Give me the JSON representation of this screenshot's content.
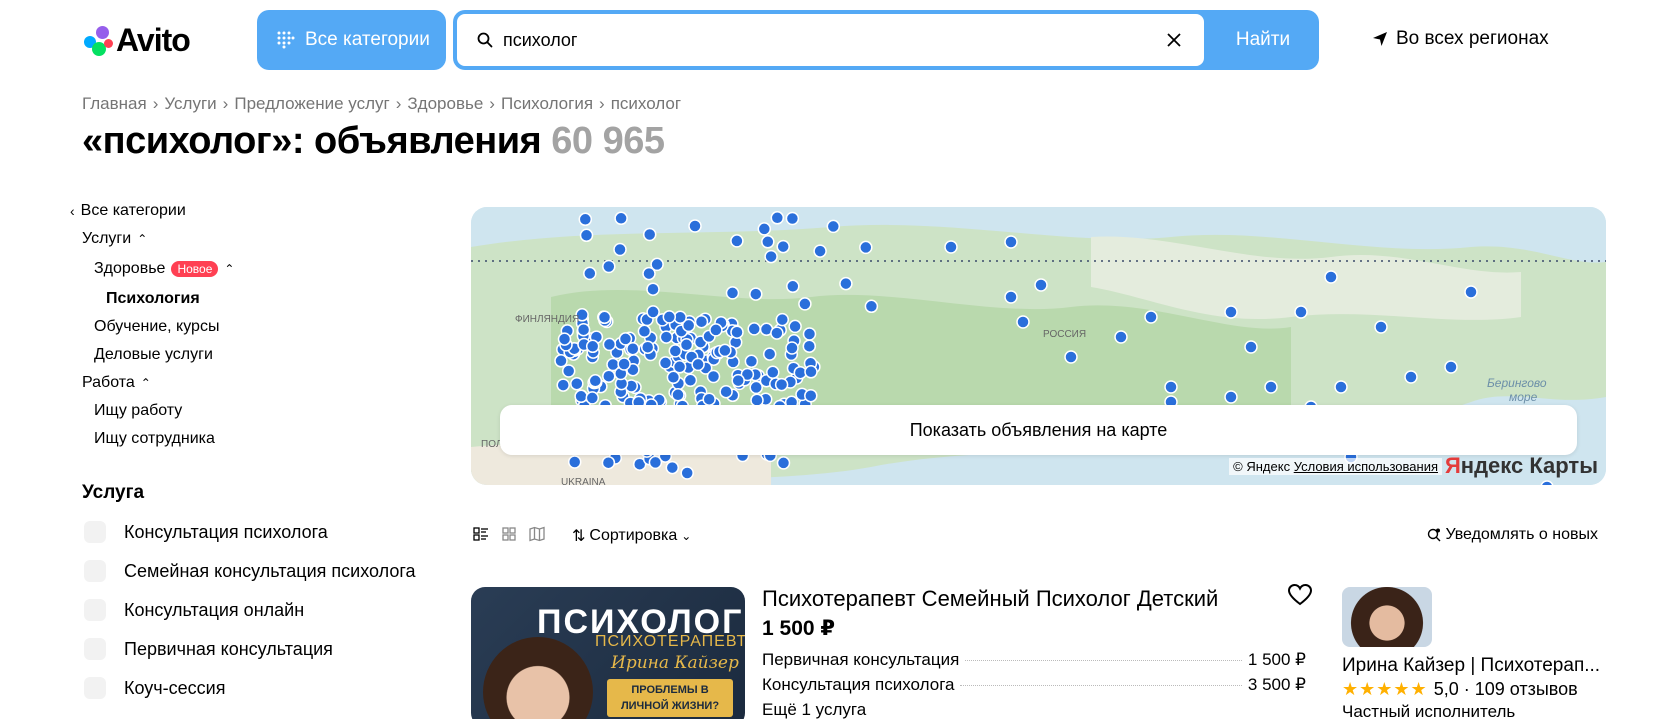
{
  "header": {
    "logo_text": "Avito",
    "categories_label": "Все категории",
    "search_value": "психолог",
    "find_label": "Найти",
    "region_label": "Во всех регионах"
  },
  "breadcrumb": [
    "Главная",
    "Услуги",
    "Предложение услуг",
    "Здоровье",
    "Психология",
    "психолог"
  ],
  "title": {
    "text": "«психолог»: объявления",
    "count": "60 965"
  },
  "sidebar": {
    "all_categories": "Все категории",
    "services": "Услуги",
    "health": "Здоровье",
    "new_badge": "Новое",
    "psychology": "Психология",
    "education": "Обучение, курсы",
    "business": "Деловые услуги",
    "work": "Работа",
    "find_job": "Ищу работу",
    "find_employee": "Ищу сотрудника",
    "service_heading": "Услуга",
    "filters": [
      "Консультация психолога",
      "Семейная консультация психолога",
      "Консультация онлайн",
      "Первичная консультация",
      "Коуч-сессия"
    ]
  },
  "map": {
    "button_label": "Показать объявления на карте",
    "attr_copy": "© Яндекс",
    "attr_terms": "Условия использования",
    "brand_red": "Я",
    "brand_rest": "ндекс Карты",
    "labels": {
      "finland": "ФИНЛЯНДИЯ",
      "russia": "РОССИЯ",
      "bering": "Берингово",
      "sea": "море",
      "ukraine": "UKRAINA",
      "pol": "ПОЛ"
    }
  },
  "toolbar": {
    "sort_label": "Сортировка",
    "notify_label": "Уведомлять о новых"
  },
  "listing": {
    "image": {
      "title": "ПСИХОЛОГ",
      "subtitle": "ПСИХОТЕРАПЕВТ",
      "name": "Ирина Кайзер",
      "box": "ПРОБЛЕМЫ В ЛИЧНОЙ ЖИЗНИ?"
    },
    "title": "Психотерапевт Семейный Психолог Детский",
    "price": "1 500 ₽",
    "services": [
      {
        "name": "Первичная консультация",
        "price": "1 500 ₽"
      },
      {
        "name": "Консультация психолога",
        "price": "3 500 ₽"
      }
    ],
    "more": "Ещё 1 услуга",
    "seller": {
      "name": "Ирина Кайзер | Психотерап...",
      "stars": "★★★★★",
      "rating": "5,0 · 109 отзывов",
      "type": "Частный исполнитель"
    }
  },
  "colors": {
    "accent": "#54a9f5",
    "marker": "#2a6fdb",
    "badge": "#ff4053"
  }
}
